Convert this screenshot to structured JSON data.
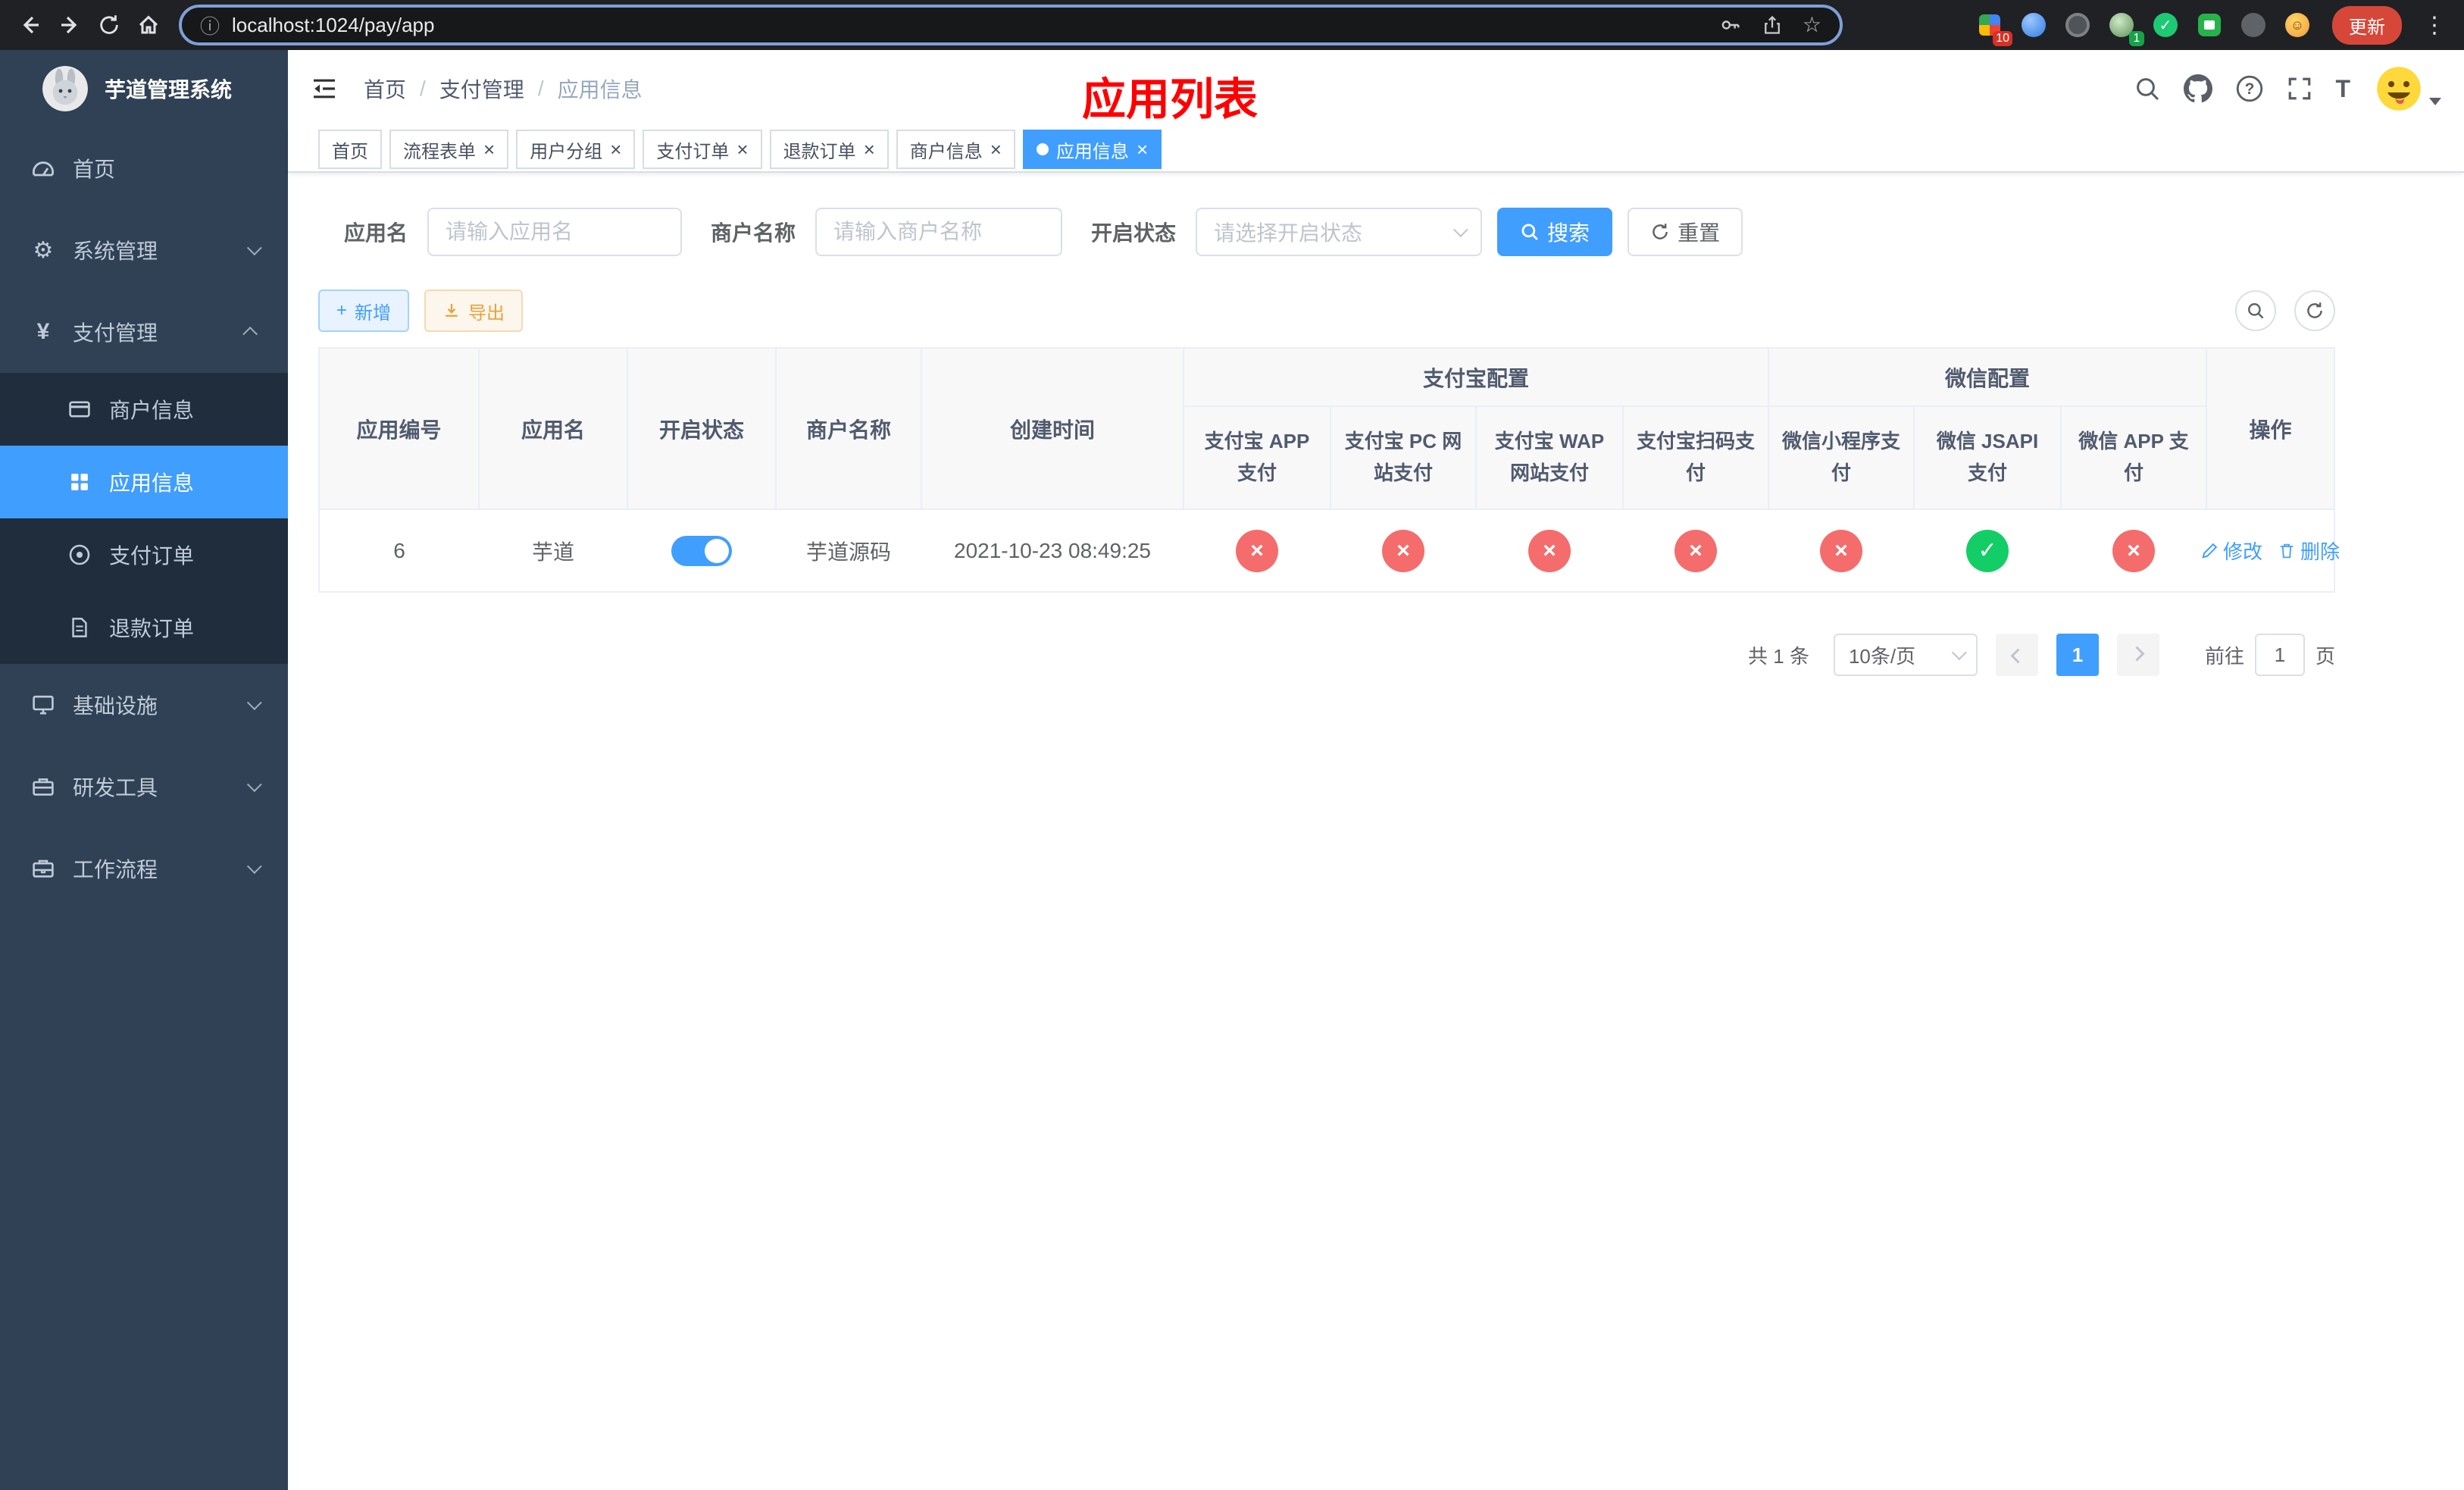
{
  "colors": {
    "primary": "#409eff",
    "danger": "#f56c6c",
    "success": "#13ce66",
    "overlay_title_red": "#ff0000",
    "warning": "#e6a23c"
  },
  "icons": {
    "info": "ⓘ",
    "star": "☆",
    "menu_dots": "⋮",
    "gear": "⚙",
    "yen": "¥",
    "plus": "+",
    "close": "×",
    "text_size": "T",
    "check": "✓",
    "cross": "×",
    "smile": "☺"
  },
  "browser": {
    "url": "localhost:1024/pay/app",
    "update_button": "更新",
    "extension_badge_grid": "10",
    "extension_badge_avatar": "1"
  },
  "sidebar": {
    "title": "芋道管理系统",
    "items": [
      {
        "label": "首页"
      },
      {
        "label": "系统管理"
      },
      {
        "label": "支付管理"
      },
      {
        "label": "基础设施"
      },
      {
        "label": "研发工具"
      },
      {
        "label": "工作流程"
      }
    ],
    "payment_submenu": [
      {
        "label": "商户信息"
      },
      {
        "label": "应用信息"
      },
      {
        "label": "支付订单"
      },
      {
        "label": "退款订单"
      }
    ]
  },
  "header": {
    "sep": "/",
    "breadcrumb": [
      {
        "label": "首页"
      },
      {
        "label": "支付管理"
      },
      {
        "label": "应用信息"
      }
    ],
    "page_overlay_title": "应用列表"
  },
  "tabs": [
    {
      "label": "首页"
    },
    {
      "label": "流程表单"
    },
    {
      "label": "用户分组"
    },
    {
      "label": "支付订单"
    },
    {
      "label": "退款订单"
    },
    {
      "label": "商户信息"
    },
    {
      "label": "应用信息"
    }
  ],
  "filters": {
    "app_name_label": "应用名",
    "app_name_placeholder": "请输入应用名",
    "merchant_label": "商户名称",
    "merchant_placeholder": "请输入商户名称",
    "status_label": "开启状态",
    "status_placeholder": "请选择开启状态",
    "search_button": "搜索",
    "reset_button": "重置"
  },
  "toolbar": {
    "add_button": "新增",
    "export_button": "导出"
  },
  "table": {
    "groups": [
      {
        "label": "支付宝配置"
      },
      {
        "label": "微信配置"
      }
    ],
    "columns": [
      "应用编号",
      "应用名",
      "开启状态",
      "商户名称",
      "创建时间",
      "支付宝 APP 支付",
      "支付宝 PC 网站支付",
      "支付宝 WAP 网站支付",
      "支付宝扫码支付",
      "微信小程序支付",
      "微信 JSAPI 支付",
      "微信 APP 支付",
      "操作"
    ],
    "rows": [
      {
        "app_id": "6",
        "app_name": "芋道",
        "enabled": "on",
        "merchant_name": "芋道源码",
        "create_time": "2021-10-23 08:49:25",
        "pay_status": [
          "no",
          "no",
          "no",
          "no",
          "no",
          "yes",
          "no"
        ],
        "action_edit": "修改",
        "action_delete": "删除"
      }
    ]
  },
  "pagination": {
    "total_text": "共 1 条",
    "page_size": "10条/页",
    "current_page": "1",
    "goto_label": "前往",
    "goto_value": "1",
    "goto_unit": "页"
  }
}
